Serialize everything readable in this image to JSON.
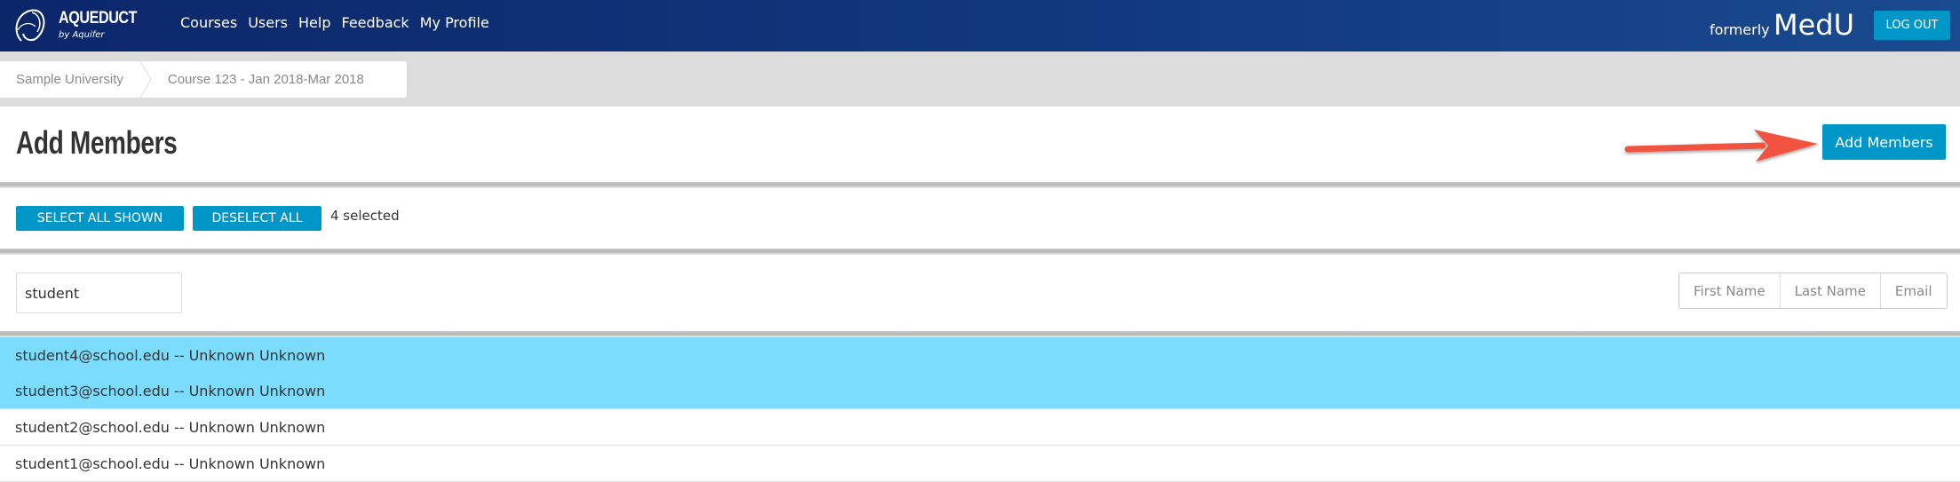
{
  "header": {
    "logo_name": "AQUEDUCT",
    "logo_sub": "by Aquifer",
    "nav": [
      "Courses",
      "Users",
      "Help",
      "Feedback",
      "My Profile"
    ],
    "formerly": "formerly",
    "brand": "MedU",
    "logout": "LOG OUT"
  },
  "breadcrumb": [
    "Sample University",
    "Course 123 - Jan 2018-Mar 2018"
  ],
  "page": {
    "title": "Add Members",
    "add_button": "Add Members"
  },
  "selection": {
    "select_all": "SELECT ALL SHOWN",
    "deselect_all": "DESELECT ALL",
    "count": "4 selected"
  },
  "filter": {
    "search_value": "student",
    "sort_options": [
      "First Name",
      "Last Name",
      "Email"
    ]
  },
  "members": [
    {
      "label": "student4@school.edu -- Unknown Unknown",
      "selected": true
    },
    {
      "label": "student3@school.edu -- Unknown Unknown",
      "selected": true
    },
    {
      "label": "student2@school.edu -- Unknown Unknown",
      "selected": false
    },
    {
      "label": "student1@school.edu -- Unknown Unknown",
      "selected": false
    }
  ],
  "colors": {
    "header": "#0c266a",
    "accent": "#0096c8",
    "selected_row": "#7bdcfd",
    "annotation_arrow": "#f0533f"
  }
}
